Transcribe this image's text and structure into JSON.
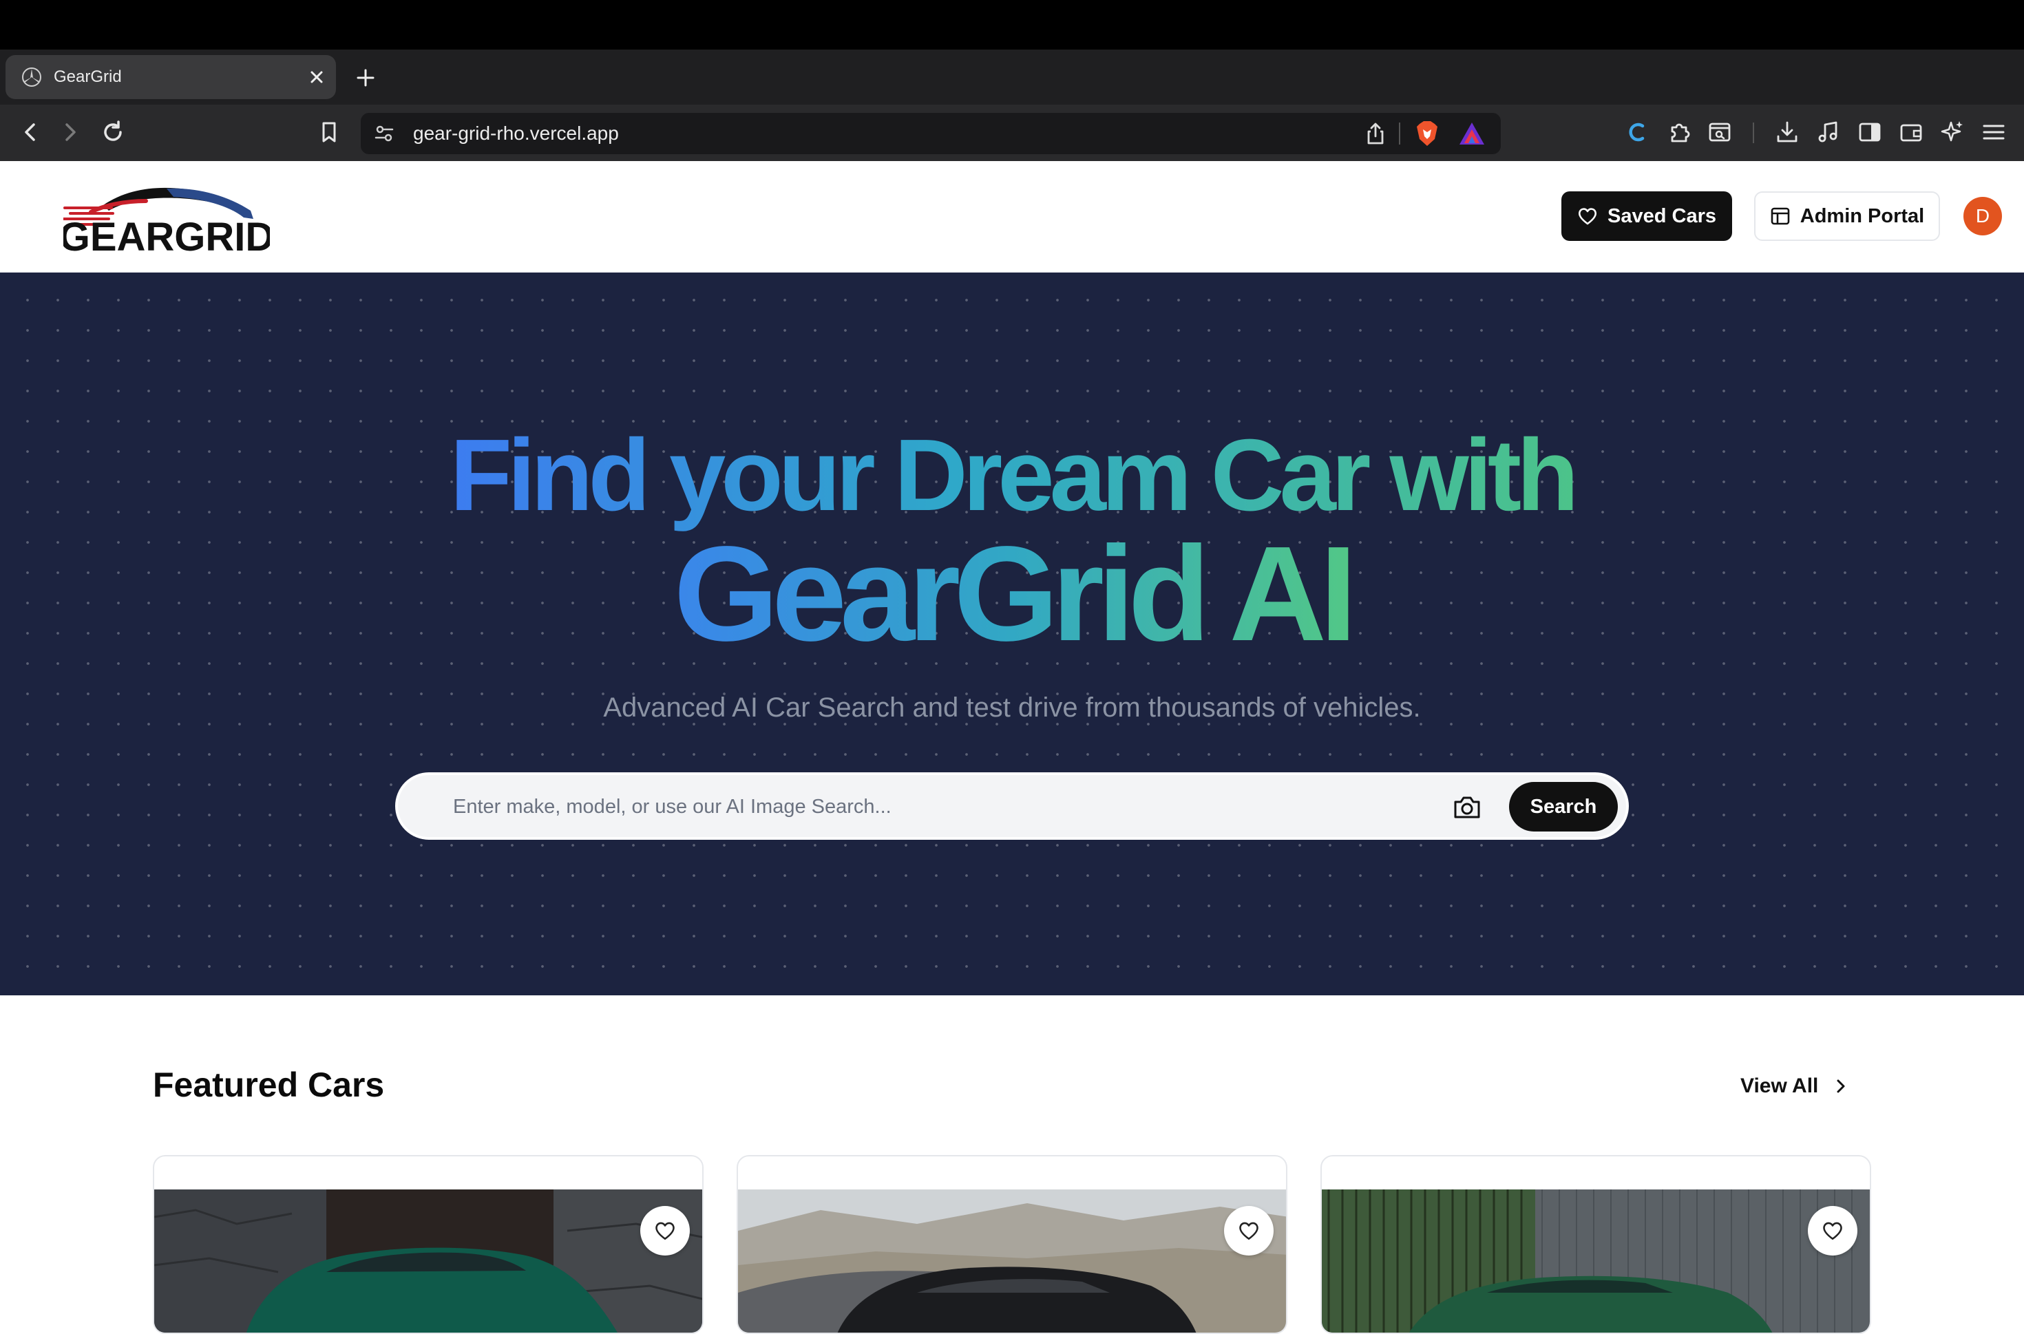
{
  "browser": {
    "tab_title": "GearGrid",
    "url": "gear-grid-rho.vercel.app"
  },
  "header": {
    "logo_text": "GEARGRID",
    "saved_label": "Saved Cars",
    "admin_label": "Admin Portal",
    "avatar_initial": "D"
  },
  "hero": {
    "line1": "Find your Dream Car with",
    "line2": "GearGrid AI",
    "subtitle": "Advanced AI Car Search and test drive from thousands of vehicles.",
    "search_placeholder": "Enter make, model, or use our AI Image Search...",
    "search_button": "Search",
    "gradient_colors": [
      "#3d7cf0",
      "#2fa8c9",
      "#4cc38a"
    ],
    "background_color": "#1c2340"
  },
  "featured": {
    "title": "Featured Cars",
    "view_all": "View All",
    "cards": [
      {
        "image": "green sedan by stone wall"
      },
      {
        "image": "black sports car on mountain road"
      },
      {
        "image": "green coupe by fence"
      }
    ]
  },
  "icons": {
    "back": "chevron-left-icon",
    "forward": "chevron-right-icon",
    "reload": "reload-icon",
    "bookmark": "bookmark-icon",
    "share": "share-icon",
    "brave": "brave-lion-icon",
    "rewards": "triangle-icon",
    "camera": "camera-icon",
    "heart": "heart-icon"
  }
}
